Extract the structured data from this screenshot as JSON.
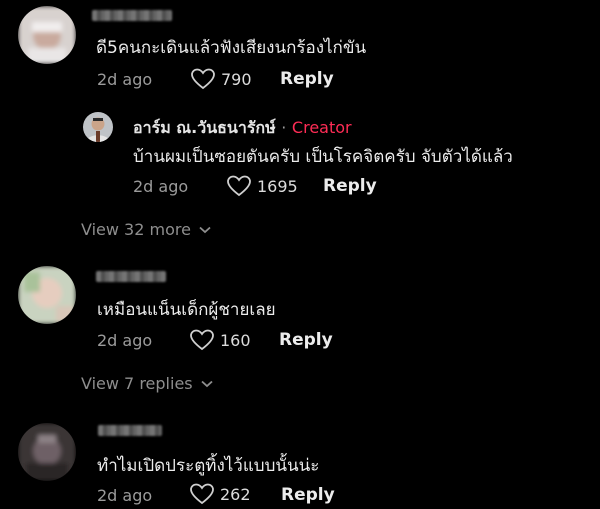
{
  "comments": [
    {
      "text": "ดี5คนกะเดินแล้วฟังเสียงนกร้องไก่ขัน",
      "time": "2d ago",
      "likes": "790",
      "reply_label": "Reply",
      "reply": {
        "author": "อาร์ม ณ.วันธนารักษ์",
        "separator": "·",
        "badge": "Creator",
        "text": "บ้านผมเป็นซอยตันครับ เป็นโรคจิตครับ จับตัวได้แล้ว",
        "time": "2d ago",
        "likes": "1695",
        "reply_label": "Reply"
      },
      "view_more": "View 32 more"
    },
    {
      "text": "เหมือนแน็นเด็กผู้ชายเลย",
      "time": "2d ago",
      "likes": "160",
      "reply_label": "Reply",
      "view_more": "View 7 replies"
    },
    {
      "text": "ทำไมเปิดประตูทิ้งไว้แบบนั้นน่ะ",
      "time": "2d ago",
      "likes": "262",
      "reply_label": "Reply"
    }
  ],
  "colors": {
    "background": "#000000",
    "creator": "#fe2c55",
    "meta": "#9b9b9b"
  },
  "icons": {
    "like": "heart-outline-icon",
    "expand": "chevron-down-icon"
  }
}
